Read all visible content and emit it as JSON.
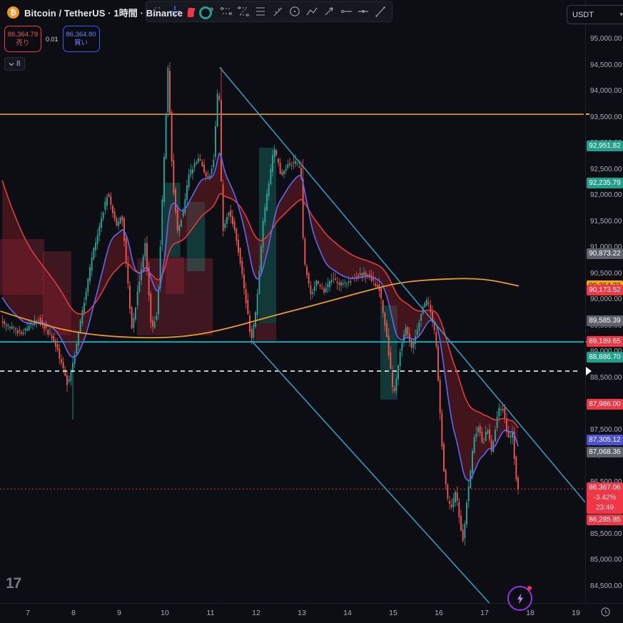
{
  "header": {
    "symbol_title": "Bitcoin / TetherUS · 1時間 · Binance",
    "sell_price": "86,364.79",
    "sell_label": "売り",
    "spread": "0.01",
    "buy_price": "86,364.80",
    "buy_label": "買い",
    "indicators_collapsed_count": "8",
    "currency_button": "USDT"
  },
  "toolbar": {
    "tools": [
      "drag-handle",
      "crosshair",
      "text",
      "brush",
      "pattern-a",
      "pattern-b",
      "pattern-c",
      "forecast",
      "ellipse",
      "polyline",
      "arrow",
      "horizontal-ray",
      "cross-line",
      "trend-line"
    ]
  },
  "watermark_logo_text": "17",
  "price_axis": {
    "tick_labels": [
      "95,000.00",
      "94,500.00",
      "94,000.00",
      "93,500.00",
      "93,000.00",
      "92,500.00",
      "92,000.00",
      "91,500.00",
      "91,000.00",
      "90,500.00",
      "90,000.00",
      "89,500.00",
      "89,000.00",
      "88,500.00",
      "88,000.00",
      "87,500.00",
      "87,000.00",
      "86,500.00",
      "86,000.00",
      "85,500.00",
      "85,000.00",
      "84,500.00"
    ],
    "top_tick_price": 95000,
    "tick_step": 500,
    "badges": [
      {
        "label": "92,951.82",
        "price": 92951.82,
        "color": "teal"
      },
      {
        "label": "92,235.79",
        "price": 92235.79,
        "color": "teal"
      },
      {
        "label": "90,873.22",
        "price": 90873.22,
        "color": "gray"
      },
      {
        "label": "90,264.23",
        "price": 90264.23,
        "color": "orange"
      },
      {
        "label": "90,173.52",
        "price": 90173.52,
        "color": "red"
      },
      {
        "label": "89,585.39",
        "price": 89585.39,
        "color": "gray"
      },
      {
        "label": "89,189.65",
        "price": 89189.65,
        "color": "red"
      },
      {
        "label": "88,886.70",
        "price": 88886.7,
        "color": "teal"
      },
      {
        "label": "87,986.00",
        "price": 87986.0,
        "color": "red"
      },
      {
        "label": "87,305.12",
        "price": 87305.12,
        "color": "blue"
      },
      {
        "label": "87,068.36",
        "price": 87068.36,
        "color": "gray"
      }
    ],
    "price_block": {
      "price_label": "86,367.06",
      "change": "-3.42%",
      "countdown": "23:49",
      "price": 86367.06
    },
    "below_block_badge": {
      "label": "86,285.85",
      "price": 86285.85,
      "color": "red"
    }
  },
  "time_axis": {
    "day_labels": [
      "7",
      "8",
      "9",
      "10",
      "11",
      "12",
      "13",
      "14",
      "15",
      "16",
      "17",
      "18",
      "19"
    ]
  },
  "chart_data": {
    "type": "candlestick",
    "symbol": "Bitcoin / TetherUS",
    "exchange": "Binance",
    "interval": "1時間",
    "last_price": 86367.06,
    "change_pct": -3.42,
    "visible_price_range": [
      84300,
      95200
    ],
    "visible_day_range": [
      6.4,
      19.4
    ],
    "price_path_waypoints": [
      [
        6.4,
        89600
      ],
      [
        6.86,
        89350
      ],
      [
        7.25,
        89650
      ],
      [
        7.61,
        89200
      ],
      [
        7.9,
        88350
      ],
      [
        8.06,
        89000
      ],
      [
        8.42,
        90800
      ],
      [
        8.77,
        92050
      ],
      [
        8.97,
        91400
      ],
      [
        9.08,
        91650
      ],
      [
        9.3,
        89400
      ],
      [
        9.44,
        90250
      ],
      [
        9.59,
        91100
      ],
      [
        9.73,
        89400
      ],
      [
        9.86,
        89800
      ],
      [
        10.09,
        94450
      ],
      [
        10.19,
        92300
      ],
      [
        10.3,
        91300
      ],
      [
        10.42,
        91700
      ],
      [
        10.55,
        92400
      ],
      [
        10.77,
        92750
      ],
      [
        10.95,
        92300
      ],
      [
        11.08,
        92600
      ],
      [
        11.2,
        94350
      ],
      [
        11.28,
        91300
      ],
      [
        11.42,
        91700
      ],
      [
        11.55,
        91350
      ],
      [
        11.7,
        90600
      ],
      [
        11.91,
        89230
      ],
      [
        12.02,
        89800
      ],
      [
        12.17,
        91500
      ],
      [
        12.41,
        92930
      ],
      [
        12.56,
        92400
      ],
      [
        12.72,
        92600
      ],
      [
        12.88,
        92650
      ],
      [
        13.0,
        92500
      ],
      [
        13.06,
        90800
      ],
      [
        13.22,
        90100
      ],
      [
        13.34,
        90350
      ],
      [
        13.5,
        90150
      ],
      [
        13.66,
        90400
      ],
      [
        13.86,
        90300
      ],
      [
        14.05,
        90350
      ],
      [
        14.2,
        90450
      ],
      [
        14.39,
        90500
      ],
      [
        14.55,
        90400
      ],
      [
        14.72,
        90200
      ],
      [
        14.88,
        89300
      ],
      [
        15.03,
        88120
      ],
      [
        15.17,
        89000
      ],
      [
        15.3,
        89480
      ],
      [
        15.42,
        89100
      ],
      [
        15.53,
        89350
      ],
      [
        15.64,
        89800
      ],
      [
        15.77,
        90000
      ],
      [
        15.88,
        89600
      ],
      [
        15.95,
        89300
      ],
      [
        16.03,
        88100
      ],
      [
        16.11,
        86900
      ],
      [
        16.2,
        86200
      ],
      [
        16.3,
        86000
      ],
      [
        16.39,
        86350
      ],
      [
        16.47,
        85800
      ],
      [
        16.55,
        85380
      ],
      [
        16.63,
        86100
      ],
      [
        16.7,
        86600
      ],
      [
        16.78,
        87300
      ],
      [
        16.89,
        87600
      ],
      [
        16.98,
        87200
      ],
      [
        17.08,
        87550
      ],
      [
        17.17,
        87100
      ],
      [
        17.25,
        87500
      ],
      [
        17.33,
        87900
      ],
      [
        17.41,
        87960
      ],
      [
        17.48,
        87600
      ],
      [
        17.56,
        87300
      ],
      [
        17.63,
        87500
      ],
      [
        17.67,
        87000
      ],
      [
        17.72,
        86500
      ],
      [
        17.76,
        86367
      ]
    ],
    "spikes": [
      {
        "day": 7.95,
        "type": "low",
        "price": 87700
      },
      {
        "day": 10.09,
        "type": "high",
        "price": 94560
      },
      {
        "day": 11.2,
        "type": "high",
        "price": 94460
      },
      {
        "day": 13.0,
        "type": "high",
        "price": 92700
      },
      {
        "day": 16.55,
        "type": "low",
        "price": 85280
      }
    ],
    "overlays": {
      "ma_fast_blue": {
        "period": 16,
        "last_value": 87305.12
      },
      "ma_slow_red": {
        "period": 48,
        "last_value": 87986.0
      },
      "ribbon_lower_value": 87068.36,
      "ma_long_orange": {
        "last_value": 90264.23,
        "waypoints": [
          [
            6.4,
            89780
          ],
          [
            7.3,
            89520
          ],
          [
            8.3,
            89330
          ],
          [
            9.5,
            89260
          ],
          [
            10.5,
            89290
          ],
          [
            11.4,
            89450
          ],
          [
            12.4,
            89700
          ],
          [
            13.3,
            89900
          ],
          [
            14.2,
            90120
          ],
          [
            15.15,
            90340
          ],
          [
            16.1,
            90400
          ],
          [
            16.97,
            90410
          ],
          [
            17.75,
            90264
          ]
        ]
      }
    },
    "horizontal_lines": [
      {
        "price": 93560,
        "color": "orange",
        "style": "solid"
      },
      {
        "price": 89189.65,
        "color": "cyan",
        "style": "solid"
      },
      {
        "price": 88630,
        "color": "white",
        "style": "dashed"
      },
      {
        "price": 86367.06,
        "color": "red",
        "style": "dotted"
      }
    ],
    "trendlines": [
      {
        "from": [
          11.2,
          94460
        ],
        "to": [
          19.35,
          85960
        ]
      },
      {
        "from": [
          11.89,
          89220
        ],
        "to": [
          17.33,
          83960
        ]
      }
    ],
    "zones": {
      "green": [
        [
          9.97,
          92246,
          10.34,
          90822
        ],
        [
          10.48,
          91876,
          10.88,
          90548
        ],
        [
          12.06,
          92918,
          12.44,
          89548
        ],
        [
          14.72,
          89890,
          15.09,
          88082
        ]
      ],
      "red": [
        [
          6.39,
          91164,
          7.36,
          90096
        ],
        [
          7.33,
          90932,
          7.95,
          89315
        ],
        [
          9.39,
          90795,
          11.05,
          89315
        ],
        [
          10.02,
          90822,
          10.42,
          90110
        ],
        [
          11.98,
          89548,
          12.44,
          89205
        ]
      ]
    },
    "colors": {
      "candle_up": "#26a69a",
      "candle_down": "#ef5350",
      "ma_fast": "#5b68f5",
      "ma_slow": "#e23a42",
      "ma_long": "#f09a1c",
      "trendline": "#2fa3c7",
      "hline_cyan": "#00dbe6",
      "hline_orange": "#f8a62a",
      "ribbon_fill": "rgba(148,32,46,0.40)",
      "zone_green": "rgba(32,158,142,0.30)",
      "zone_red": "rgba(165,42,58,0.34)"
    }
  }
}
